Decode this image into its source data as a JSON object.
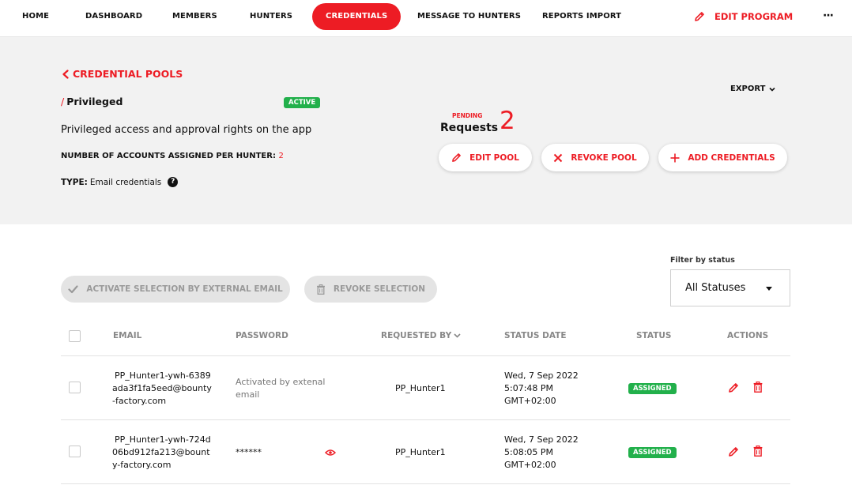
{
  "nav": {
    "items": [
      {
        "label": "HOME"
      },
      {
        "label": "DASHBOARD"
      },
      {
        "label": "MEMBERS"
      },
      {
        "label": "HUNTERS"
      },
      {
        "label": "CREDENTIALS",
        "active": true
      },
      {
        "label": "MESSAGE TO HUNTERS"
      },
      {
        "label": "REPORTS IMPORT"
      }
    ],
    "edit_program": "EDIT PROGRAM",
    "more": "···"
  },
  "header": {
    "back_label": "CREDENTIAL POOLS",
    "pool_name": "Privileged",
    "pool_status": "ACTIVE",
    "description": "Privileged access and approval rights on the app",
    "accounts_label": "NUMBER OF ACCOUNTS ASSIGNED PER HUNTER:",
    "accounts_value": "2",
    "type_label": "TYPE:",
    "type_value": "Email credentials",
    "help": "?",
    "export_label": "EXPORT",
    "pending_label": "PENDING",
    "requests_label": "Requests",
    "pending_count": "2",
    "buttons": {
      "edit_pool": "EDIT POOL",
      "revoke_pool": "REVOKE POOL",
      "add_credentials": "ADD CREDENTIALS"
    }
  },
  "actions": {
    "activate_selection": "ACTIVATE SELECTION BY EXTERNAL EMAIL",
    "revoke_selection": "REVOKE SELECTION",
    "filter_label": "Filter by status",
    "filter_value": "All Statuses"
  },
  "table": {
    "headers": {
      "email": "EMAIL",
      "password": "PASSWORD",
      "requested_by": "REQUESTED BY",
      "status_date": "STATUS DATE",
      "status": "STATUS",
      "actions": "ACTIONS"
    },
    "rows": [
      {
        "email_lines": [
          "PP_Hunter1-ywh-6389",
          "ada3f1fa5eed@bounty",
          "-factory.com"
        ],
        "password_lines": [
          "Activated by extenal",
          "email"
        ],
        "requested_by": "PP_Hunter1",
        "date_lines": [
          "Wed, 7 Sep 2022",
          "5:07:48 PM",
          "GMT+02:00"
        ],
        "status": "ASSIGNED"
      },
      {
        "email_lines": [
          "PP_Hunter1-ywh-724d",
          "06bd912fa213@bount",
          "y-factory.com"
        ],
        "password_lines": [
          "******"
        ],
        "requested_by": "PP_Hunter1",
        "date_lines": [
          "Wed, 7 Sep 2022",
          "5:08:05 PM",
          "GMT+02:00"
        ],
        "status": "ASSIGNED"
      }
    ]
  },
  "colors": {
    "accent": "#ed1c24",
    "success": "#22b04b",
    "panel": "#f2f2f2"
  }
}
